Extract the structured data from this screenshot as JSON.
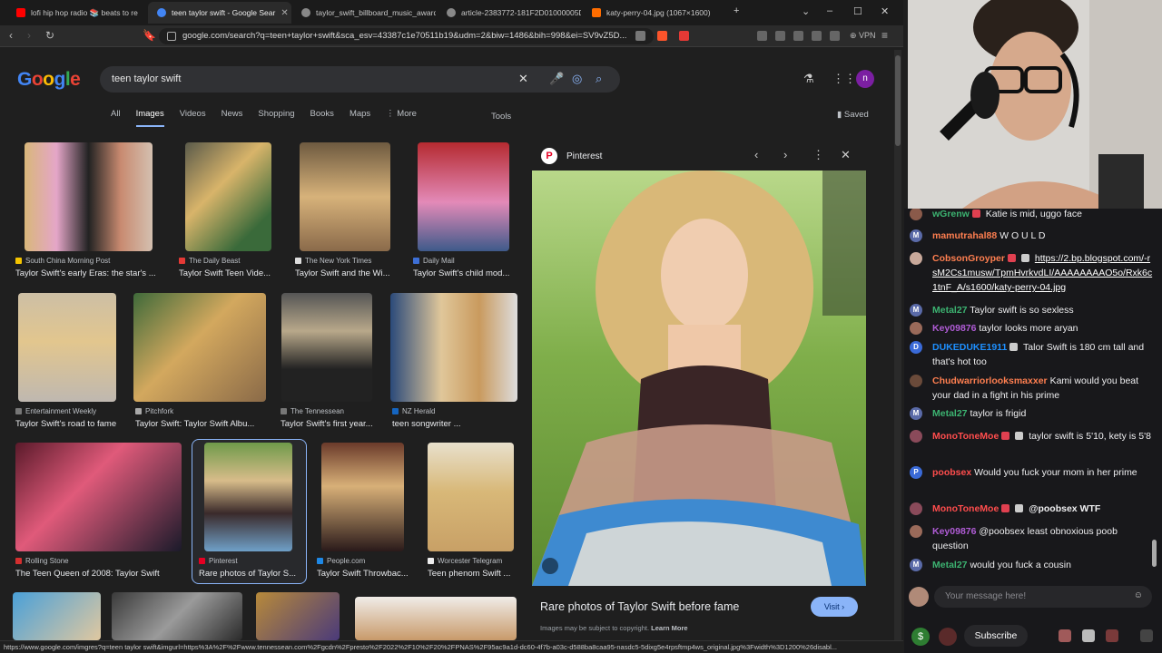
{
  "browser": {
    "tabs": [
      {
        "label": "lofi hip hop radio 📚 beats to re",
        "active": false
      },
      {
        "label": "teen taylor swift - Google Sear",
        "active": true
      },
      {
        "label": "taylor_swift_billboard_music_award",
        "active": false
      },
      {
        "label": "article-2383772-181F2D01000005D",
        "active": false
      },
      {
        "label": "katy-perry-04.jpg (1067×1600)",
        "active": false
      }
    ],
    "new_tab": "+",
    "url": "google.com/search?q=teen+taylor+swift&sca_esv=43387c1e70511b19&udm=2&biw=1486&bih=998&ei=SV9vZ5D...",
    "vpn_label": "VPN",
    "status_url": "https://www.google.com/imgres?q=teen taylor swift&imgurl=https%3A%2F%2Fwww.tennessean.com%2Fgcdn%2Fpresto%2F2022%2F10%2F20%2FPNAS%2F95ac9a1d-dc60-4f7b-a03c-d588ba8caa95-nasdc5-5dixg5e4rpsftmp4ws_original.jpg%3Fwidth%3D1200%26disabl..."
  },
  "google": {
    "logo": "Google",
    "query": "teen taylor swift",
    "avatar_letter": "n",
    "tabs": [
      "All",
      "Images",
      "Videos",
      "News",
      "Shopping",
      "Books",
      "Maps",
      "⋮ More"
    ],
    "active_tab": "Images",
    "tools": "Tools",
    "saved": "Saved"
  },
  "results": [
    {
      "source": "South China Morning Post",
      "title": "Taylor Swift's early Eras: the star's ..."
    },
    {
      "source": "The Daily Beast",
      "title": "Taylor Swift Teen Vide..."
    },
    {
      "source": "The New York Times",
      "title": "Taylor Swift and the Wi..."
    },
    {
      "source": "Daily Mail",
      "title": "Taylor Swift's child mod..."
    },
    {
      "source": "Entertainment Weekly",
      "title": "Taylor Swift's road to fame"
    },
    {
      "source": "Pitchfork",
      "title": "Taylor Swift: Taylor Swift Albu..."
    },
    {
      "source": "The Tennessean",
      "title": "Taylor Swift's first year..."
    },
    {
      "source": "NZ Herald",
      "title": "teen songwriter ..."
    },
    {
      "source": "Rolling Stone",
      "title": "The Teen Queen of 2008: Taylor Swift"
    },
    {
      "source": "Pinterest",
      "title": "Rare photos of Taylor S..."
    },
    {
      "source": "People.com",
      "title": "Taylor Swift Throwbac..."
    },
    {
      "source": "Worcester Telegram",
      "title": "Teen phenom Swift ..."
    }
  ],
  "preview": {
    "source": "Pinterest",
    "title": "Rare photos of Taylor Swift before fame",
    "copyright": "Images may be subject to copyright.",
    "learn_more": "Learn More",
    "visit": "Visit ›"
  },
  "chat": {
    "messages": [
      {
        "user": "wGrenw",
        "color": "#3cb371",
        "avatar": "",
        "text": "Katie is mid, uggo face"
      },
      {
        "user": "mamutrahal88",
        "color": "#ff7f50",
        "avatar": "M",
        "text": "W O U L D"
      },
      {
        "user": "CobsonGroyper",
        "color": "#ff7f50",
        "avatar": "",
        "text": "https://2.bp.blogspot.com/-rsM2Cs1musw/TpmHvrkvdLI/AAAAAAAAO5o/Rxk6c1tnF_A/s1600/katy-perry-04.jpg",
        "link": true
      },
      {
        "user": "Metal27",
        "color": "#3cb371",
        "avatar": "M",
        "text": "Taylor swift is so sexless"
      },
      {
        "user": "Key09876",
        "color": "#b05cd6",
        "avatar": "",
        "text": "taylor looks more aryan"
      },
      {
        "user": "DUKEDUKE1911",
        "color": "#1e90ff",
        "avatar": "D",
        "text": "Talor Swift is 180 cm tall and that's hot too"
      },
      {
        "user": "Chudwarriorlooksmaxxer",
        "color": "#ff7f50",
        "avatar": "",
        "text": "Kami would you beat your dad in a fight in his prime"
      },
      {
        "user": "Metal27",
        "color": "#3cb371",
        "avatar": "M",
        "text": "taylor is frigid"
      },
      {
        "user": "MonoToneMoe",
        "color": "#ff4d4d",
        "avatar": "",
        "text": "taylor swift is 5'10, kety is 5'8"
      },
      {
        "user": "poobsex",
        "color": "#ff4d4d",
        "avatar": "P",
        "text": "Would you fuck your mom in her prime"
      },
      {
        "user": "MonoToneMoe",
        "color": "#ff4d4d",
        "avatar": "",
        "text": "@poobsex WTF"
      },
      {
        "user": "Key09876",
        "color": "#b05cd6",
        "avatar": "",
        "text": "@poobsex least obnoxious poob question"
      },
      {
        "user": "Metal27",
        "color": "#3cb371",
        "avatar": "M",
        "text": "would you fuck a cousin"
      }
    ],
    "input_placeholder": "Your message here!",
    "subscribe": "Subscribe"
  }
}
